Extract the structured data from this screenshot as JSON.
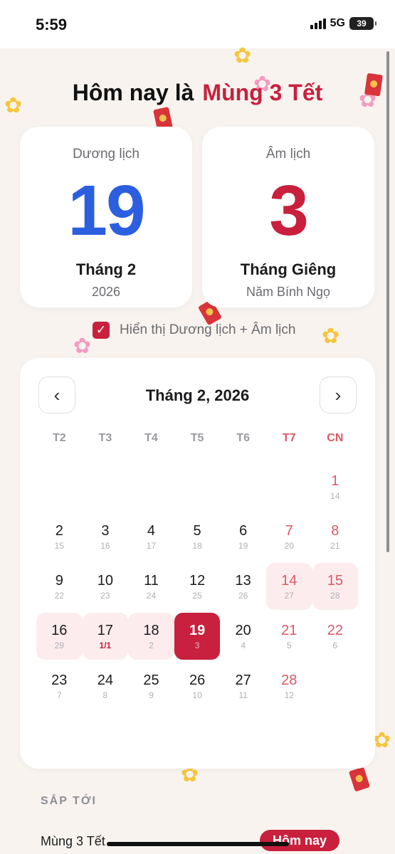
{
  "status": {
    "time": "5:59",
    "network": "5G",
    "battery": "39"
  },
  "header": {
    "prefix": "Hôm nay là",
    "highlight": "Mùng 3 Tết"
  },
  "solar_card": {
    "label": "Dương lịch",
    "day": "19",
    "month": "Tháng 2",
    "year": "2026"
  },
  "lunar_card": {
    "label": "Âm lịch",
    "day": "3",
    "month": "Tháng Giêng",
    "year": "Năm Bính Ngọ"
  },
  "toggle": {
    "checked": true,
    "label": "Hiển thị Dương lịch + Âm lịch",
    "check_glyph": "✓"
  },
  "calendar": {
    "title": "Tháng 2, 2026",
    "prev_glyph": "‹",
    "next_glyph": "›",
    "weekdays": [
      "T2",
      "T3",
      "T4",
      "T5",
      "T6",
      "T7",
      "CN"
    ],
    "weeks": [
      [
        null,
        null,
        null,
        null,
        null,
        null,
        {
          "s": "1",
          "l": "14"
        }
      ],
      [
        {
          "s": "2",
          "l": "15"
        },
        {
          "s": "3",
          "l": "16"
        },
        {
          "s": "4",
          "l": "17"
        },
        {
          "s": "5",
          "l": "18"
        },
        {
          "s": "6",
          "l": "19"
        },
        {
          "s": "7",
          "l": "20"
        },
        {
          "s": "8",
          "l": "21"
        }
      ],
      [
        {
          "s": "9",
          "l": "22"
        },
        {
          "s": "10",
          "l": "23"
        },
        {
          "s": "11",
          "l": "24"
        },
        {
          "s": "12",
          "l": "25"
        },
        {
          "s": "13",
          "l": "26"
        },
        {
          "s": "14",
          "l": "27",
          "tet": true
        },
        {
          "s": "15",
          "l": "28",
          "tet": true
        }
      ],
      [
        {
          "s": "16",
          "l": "29",
          "tet": true
        },
        {
          "s": "17",
          "l": "1/1",
          "tet": true,
          "first": true
        },
        {
          "s": "18",
          "l": "2",
          "tet": true
        },
        {
          "s": "19",
          "l": "3",
          "today": true
        },
        {
          "s": "20",
          "l": "4"
        },
        {
          "s": "21",
          "l": "5"
        },
        {
          "s": "22",
          "l": "6"
        }
      ],
      [
        {
          "s": "23",
          "l": "7"
        },
        {
          "s": "24",
          "l": "8"
        },
        {
          "s": "25",
          "l": "9"
        },
        {
          "s": "26",
          "l": "10"
        },
        {
          "s": "27",
          "l": "11"
        },
        {
          "s": "28",
          "l": "12"
        },
        null
      ]
    ]
  },
  "upcoming": {
    "heading": "SẮP TỚI",
    "items": [
      {
        "name": "Mùng 3 Tết",
        "badge": "Hôm nay"
      }
    ]
  },
  "colors": {
    "accent": "#c8203d",
    "solar_blue": "#2c5fe0",
    "background": "#f8f3ee"
  },
  "icons": {
    "flower": "✿",
    "envelope": "red-envelope-icon"
  }
}
